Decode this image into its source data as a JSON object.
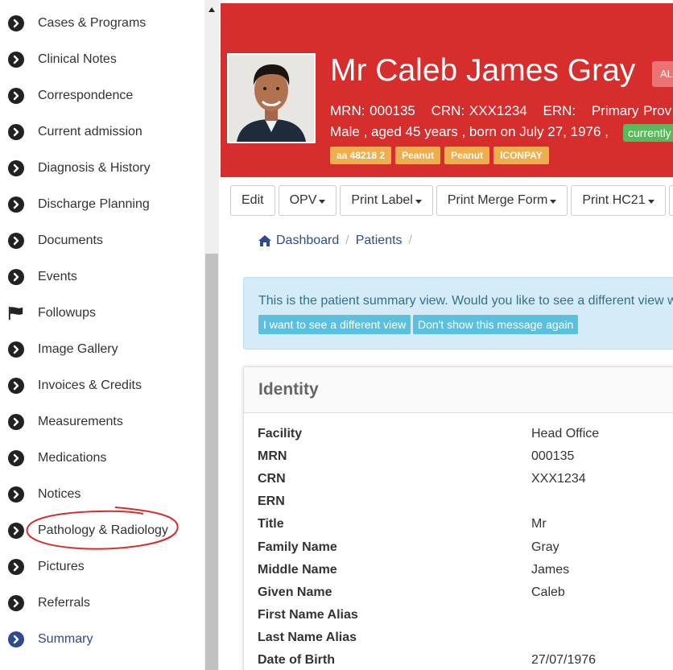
{
  "sidebar": {
    "items": [
      {
        "label": "Cases & Programs",
        "icon": "chevron-circle-right-icon"
      },
      {
        "label": "Clinical Notes",
        "icon": "chevron-circle-right-icon"
      },
      {
        "label": "Correspondence",
        "icon": "chevron-circle-right-icon"
      },
      {
        "label": "Current admission",
        "icon": "chevron-circle-right-icon"
      },
      {
        "label": "Diagnosis & History",
        "icon": "chevron-circle-right-icon"
      },
      {
        "label": "Discharge Planning",
        "icon": "chevron-circle-right-icon"
      },
      {
        "label": "Documents",
        "icon": "chevron-circle-right-icon"
      },
      {
        "label": "Events",
        "icon": "chevron-circle-right-icon"
      },
      {
        "label": "Followups",
        "icon": "flag-icon"
      },
      {
        "label": "Image Gallery",
        "icon": "chevron-circle-right-icon"
      },
      {
        "label": "Invoices & Credits",
        "icon": "chevron-circle-right-icon"
      },
      {
        "label": "Measurements",
        "icon": "chevron-circle-right-icon"
      },
      {
        "label": "Medications",
        "icon": "chevron-circle-right-icon"
      },
      {
        "label": "Notices",
        "icon": "chevron-circle-right-icon"
      },
      {
        "label": "Pathology & Radiology",
        "icon": "chevron-circle-right-icon"
      },
      {
        "label": "Pictures",
        "icon": "chevron-circle-right-icon"
      },
      {
        "label": "Referrals",
        "icon": "chevron-circle-right-icon"
      },
      {
        "label": "Summary",
        "icon": "chevron-circle-right-icon",
        "active": true
      }
    ],
    "annotation_color": "#d32f2f"
  },
  "header": {
    "name": "Mr Caleb James Gray",
    "alert_badge": "AL",
    "mrn": "MRN: 000135",
    "crn": "CRN: XXX1234",
    "ern": "ERN:",
    "provider": "Primary Prov",
    "demographics": "Male , aged 45 years , born on July 27, 1976 ,",
    "status_badge": "currently",
    "tags": [
      "aa 48218 2",
      "Peanut",
      "Peanut",
      "ICONPAY"
    ],
    "bg_color": "#d62d2d"
  },
  "toolbar": {
    "buttons": [
      {
        "label": "Edit",
        "dropdown": false
      },
      {
        "label": "OPV",
        "dropdown": true
      },
      {
        "label": "Print Label",
        "dropdown": true
      },
      {
        "label": "Print Merge Form",
        "dropdown": true
      },
      {
        "label": "Print HC21",
        "dropdown": true
      }
    ]
  },
  "breadcrumb": {
    "home": "Dashboard",
    "current": "Patients"
  },
  "info": {
    "text": "This is the patient summary view. Would you like to see a different view w",
    "btn_change": "I want to see a different view",
    "btn_dismiss": "Don't show this message again"
  },
  "identity": {
    "title": "Identity",
    "rows": [
      {
        "label": "Facility",
        "value": "Head Office"
      },
      {
        "label": "MRN",
        "value": "000135"
      },
      {
        "label": "CRN",
        "value": "XXX1234"
      },
      {
        "label": "ERN",
        "value": ""
      },
      {
        "label": "Title",
        "value": "Mr"
      },
      {
        "label": "Family Name",
        "value": "Gray"
      },
      {
        "label": "Middle Name",
        "value": "James"
      },
      {
        "label": "Given Name",
        "value": "Caleb"
      },
      {
        "label": "First Name Alias",
        "value": ""
      },
      {
        "label": "Last Name Alias",
        "value": ""
      },
      {
        "label": "Date of Birth",
        "value": "27/07/1976"
      }
    ]
  }
}
